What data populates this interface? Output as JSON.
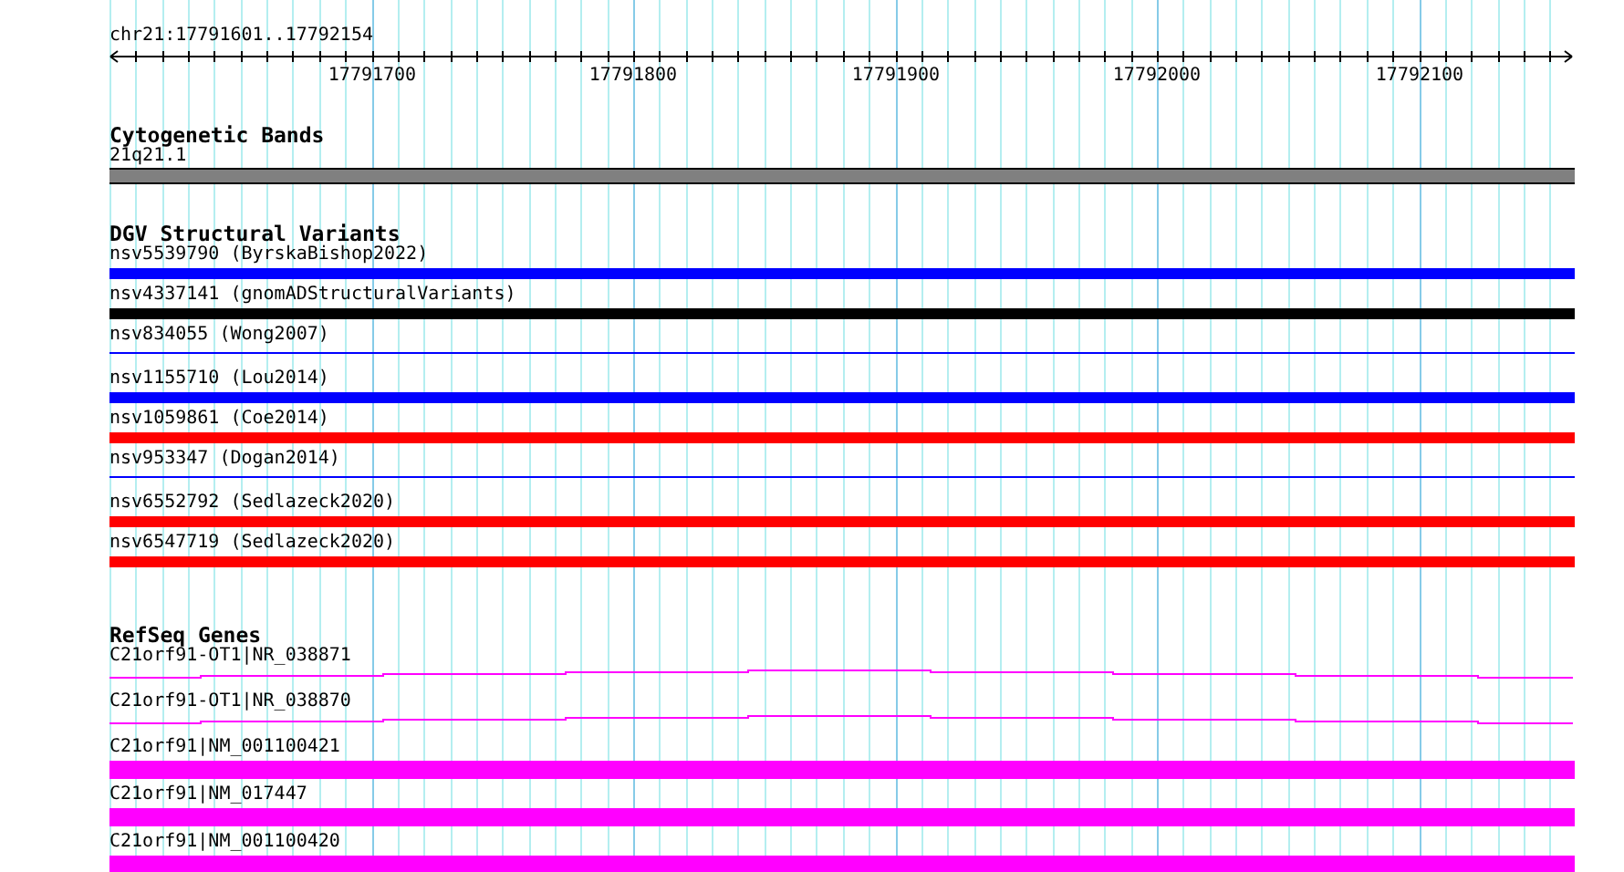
{
  "ruler": {
    "region": "chr21:17791601..17792154",
    "tick_labels": [
      "17791700",
      "17791800",
      "17791900",
      "17792000",
      "17792100"
    ]
  },
  "tracks": [
    {
      "title": "Cytogenetic Bands",
      "features": [
        {
          "label": "21q21.1",
          "kind": "band"
        }
      ]
    },
    {
      "title": "DGV Structural Variants",
      "features": [
        {
          "label": "nsv5539790 (ByrskaBishop2022)",
          "kind": "thick",
          "color": "#0000ff"
        },
        {
          "label": "nsv4337141 (gnomADStructuralVariants)",
          "kind": "thick",
          "color": "#000000"
        },
        {
          "label": "nsv834055 (Wong2007)",
          "kind": "thin",
          "color": "#0000ff"
        },
        {
          "label": "nsv1155710 (Lou2014)",
          "kind": "thick",
          "color": "#0000ff"
        },
        {
          "label": "nsv1059861 (Coe2014)",
          "kind": "thick",
          "color": "#ff0000"
        },
        {
          "label": "nsv953347 (Dogan2014)",
          "kind": "thin",
          "color": "#0000ff"
        },
        {
          "label": "nsv6552792 (Sedlazeck2020)",
          "kind": "thick",
          "color": "#ff0000"
        },
        {
          "label": "nsv6547719 (Sedlazeck2020)",
          "kind": "thick",
          "color": "#ff0000"
        }
      ]
    },
    {
      "title": "RefSeq Genes",
      "features": [
        {
          "label": "C21orf91-OT1|NR_038871",
          "kind": "line"
        },
        {
          "label": "C21orf91-OT1|NR_038870",
          "kind": "line"
        },
        {
          "label": "C21orf91|NM_001100421",
          "kind": "block"
        },
        {
          "label": "C21orf91|NM_017447",
          "kind": "block"
        },
        {
          "label": "C21orf91|NM_001100420",
          "kind": "block"
        }
      ]
    }
  ]
}
